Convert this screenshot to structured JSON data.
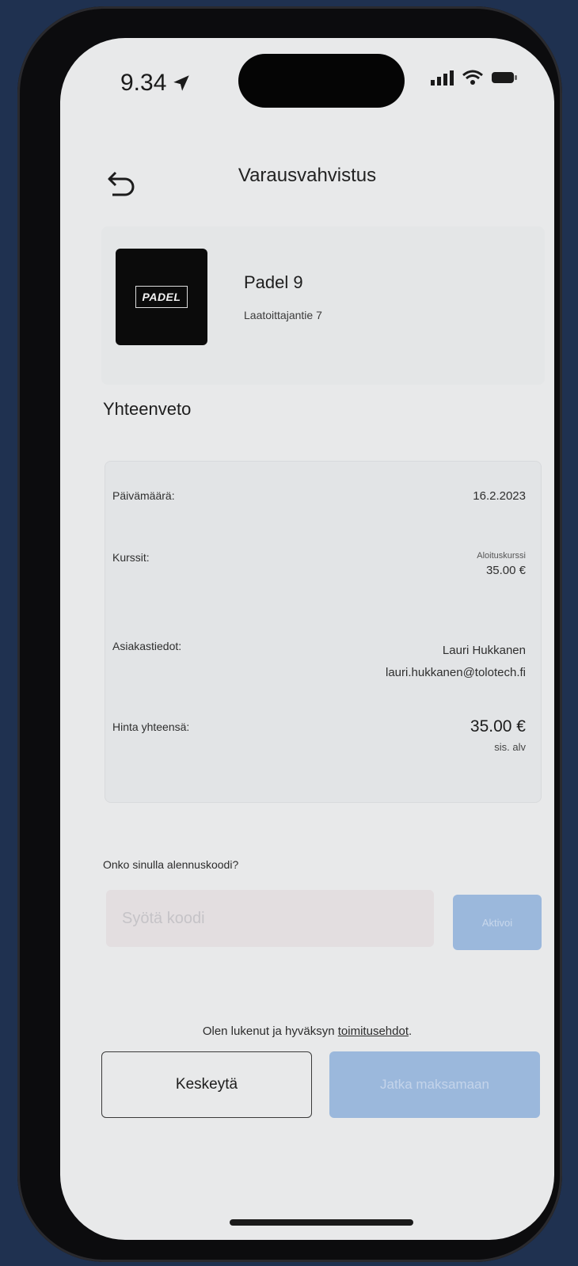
{
  "status_bar": {
    "time": "9.34"
  },
  "nav": {
    "title": "Varausvahvistus"
  },
  "venue": {
    "logo_text": "PADEL",
    "name": "Padel 9",
    "address": "Laatoittajantie 7"
  },
  "summary": {
    "title": "Yhteenveto",
    "date_label": "Päivämäärä:",
    "date_value": "16.2.2023",
    "courses_label": "Kurssit:",
    "course_name": "Aloituskurssi",
    "course_price": "35.00 €",
    "customer_label": "Asiakastiedot:",
    "customer_name": "Lauri Hukkanen",
    "customer_email": "lauri.hukkanen@tolotech.fi",
    "total_label": "Hinta yhteensä:",
    "total_value": "35.00 €",
    "vat_note": "sis. alv"
  },
  "discount": {
    "question": "Onko sinulla alennuskoodi?",
    "placeholder": "Syötä koodi",
    "activate_label": "Aktivoi"
  },
  "terms": {
    "prefix": "Olen lukenut ja hyväksyn ",
    "link": "toimitusehdot",
    "suffix": "."
  },
  "actions": {
    "cancel": "Keskeytä",
    "continue": "Jatka maksamaan"
  }
}
